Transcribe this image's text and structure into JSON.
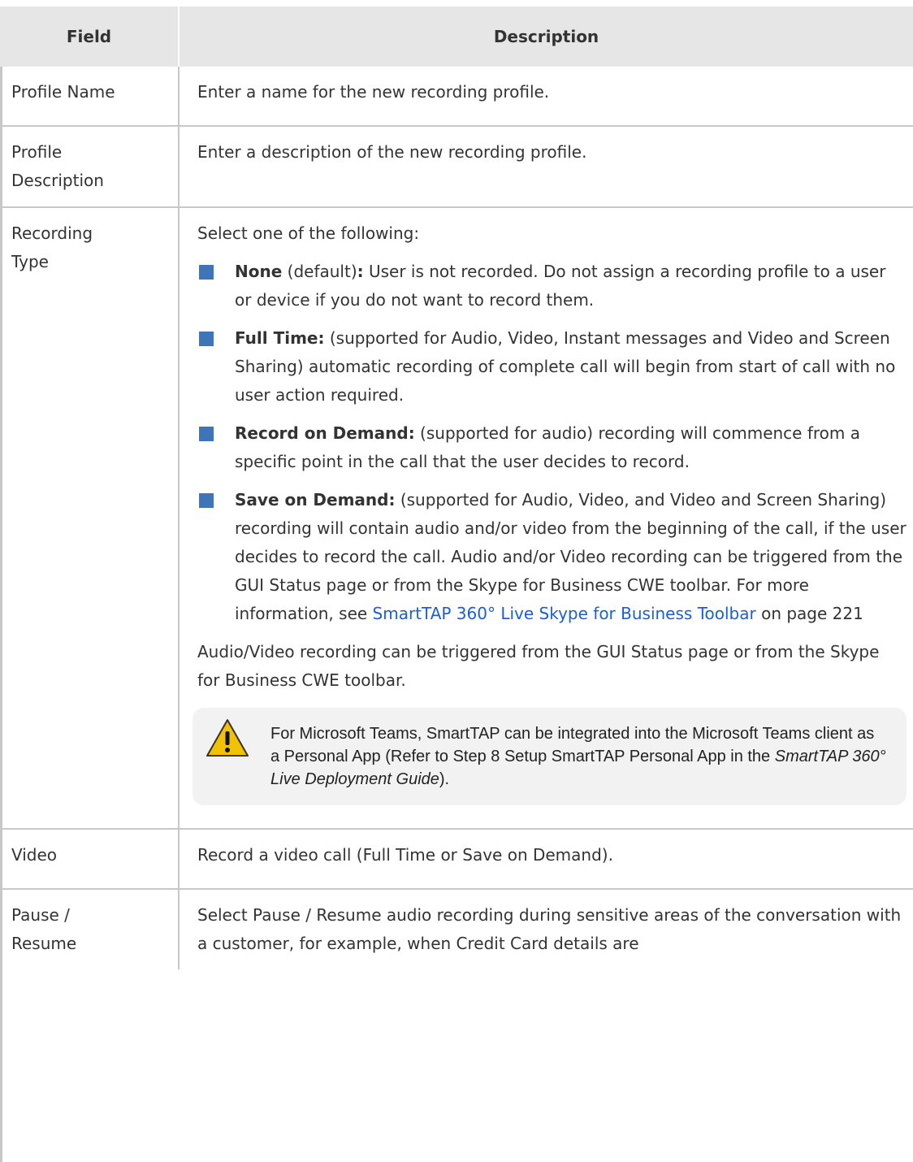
{
  "header": {
    "field": "Field",
    "description": "Description"
  },
  "rows": {
    "profile_name": {
      "field": "Profile Name",
      "desc": "Enter a name for the new recording profile."
    },
    "profile_description": {
      "field_1": "Profile",
      "field_2": "Description",
      "desc": "Enter a description of the new recording profile."
    },
    "recording_type": {
      "field_1": "Recording",
      "field_2": "Type",
      "intro": "Select one of the following:",
      "items": [
        {
          "bold": "None",
          "bold_suffix": " (default)",
          "colon": ":",
          "text": "  User is not recorded. Do not assign a recording profile to a user or device if you do not want to record them."
        },
        {
          "bold": "Full Time:",
          "text": " (supported for Audio, Video, Instant messages and Video and Screen Sharing) automatic recording of complete call will begin from start of call with no user action required."
        },
        {
          "bold": "Record on Demand:",
          "text": " (supported for audio) recording will commence from a specific point in the call that the user decides to record."
        },
        {
          "bold": "Save on Demand:",
          "text": " (supported for Audio, Video, and Video and Screen Sharing) recording will contain audio and/or video from the beginning of the call, if the user decides to record the call. Audio and/or Video recording can be triggered from the GUI Status page or from the Skype for Business CWE toolbar. For more information, see ",
          "link": "SmartTAP 360° Live Skype for Business Toolbar",
          "tail": " on page 221"
        }
      ],
      "after": "Audio/Video recording can be triggered from the GUI Status page or from the Skype for Business CWE toolbar.",
      "note": {
        "icon": "warning-icon",
        "text_1": "For Microsoft Teams, SmartTAP can be integrated into the Microsoft Teams client as a Personal App (Refer to Step 8 Setup SmartTAP Personal App in the ",
        "italic": "SmartTAP 360° Live Deployment Guide",
        "text_2": ")."
      }
    },
    "video": {
      "field": "Video",
      "desc": "Record a video call (Full Time or Save on Demand)."
    },
    "pause_resume": {
      "field_1": "Pause /",
      "field_2": "Resume",
      "desc": "Select Pause / Resume audio recording during sensitive areas of the conversation with a customer, for example, when Credit Card details are"
    }
  },
  "colors": {
    "bullet": "#3d75b8",
    "link": "#1a5fd6",
    "header_bg": "#e6e6e6",
    "note_bg": "#f2f2f2"
  }
}
